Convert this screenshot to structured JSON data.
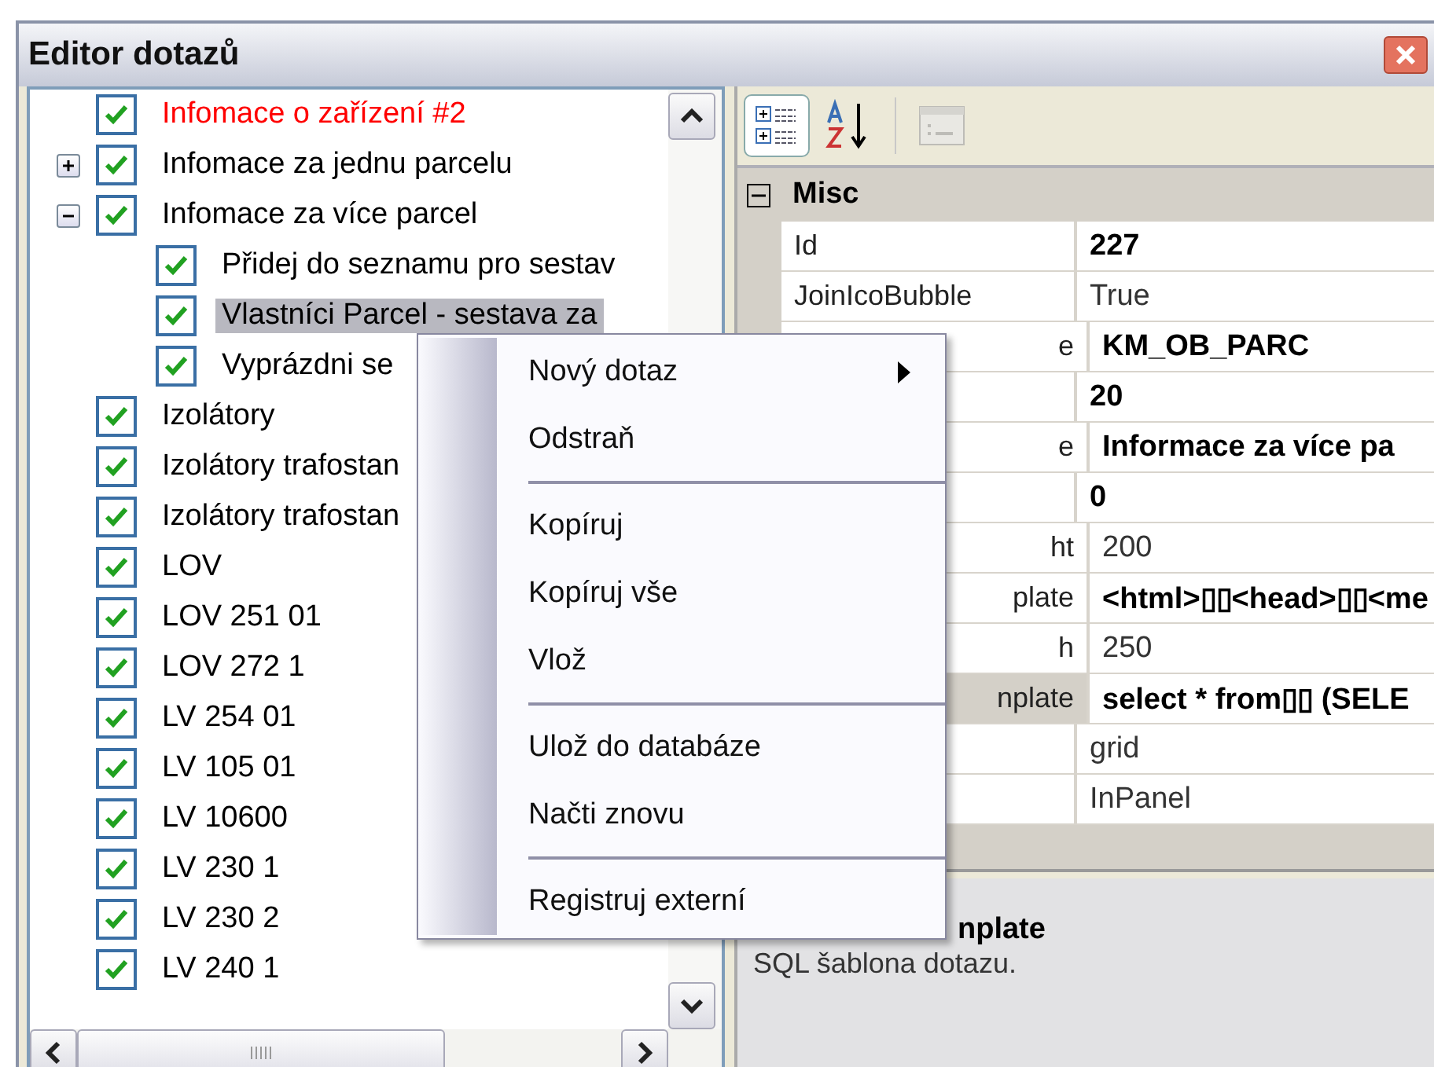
{
  "window": {
    "title": "Editor dotazů"
  },
  "tree": [
    {
      "label": "Infomace o zařízení #2",
      "checked": true,
      "selected": false,
      "color": "#ff0000"
    },
    {
      "label": "Infomace za jednu parcelu",
      "checked": true,
      "selected": false,
      "color": "#000000",
      "expanded": false
    },
    {
      "label": "Infomace za více parcel",
      "checked": true,
      "selected": false,
      "color": "#000000",
      "expanded": true,
      "children": [
        {
          "label": "Přidej do seznamu pro sestav",
          "checked": true,
          "selected": false,
          "color": "#000000"
        },
        {
          "label": "Vlastníci Parcel - sestava za",
          "checked": true,
          "selected": true,
          "color": "#000000"
        },
        {
          "label": "Vyprázdni se",
          "checked": true,
          "selected": false,
          "color": "#000000"
        }
      ]
    },
    {
      "label": "Izolátory",
      "checked": true,
      "selected": false,
      "color": "#000000"
    },
    {
      "label": "Izolátory trafostan",
      "checked": true,
      "selected": false,
      "color": "#000000"
    },
    {
      "label": "Izolátory trafostan",
      "checked": true,
      "selected": false,
      "color": "#000000"
    },
    {
      "label": "LOV",
      "checked": true,
      "selected": false,
      "color": "#000000"
    },
    {
      "label": "LOV 251 01",
      "checked": true,
      "selected": false,
      "color": "#000000"
    },
    {
      "label": "LOV 272 1",
      "checked": true,
      "selected": false,
      "color": "#000000"
    },
    {
      "label": "LV  254 01",
      "checked": true,
      "selected": false,
      "color": "#000000"
    },
    {
      "label": "LV 105 01",
      "checked": true,
      "selected": false,
      "color": "#000000"
    },
    {
      "label": "LV 10600",
      "checked": true,
      "selected": false,
      "color": "#000000"
    },
    {
      "label": "LV 230 1",
      "checked": true,
      "selected": false,
      "color": "#000000"
    },
    {
      "label": "LV 230 2",
      "checked": true,
      "selected": false,
      "color": "#000000"
    },
    {
      "label": "LV 240 1",
      "checked": true,
      "selected": false,
      "color": "#000000"
    }
  ],
  "property_grid": {
    "category": {
      "label": "Misc",
      "expanded": true
    },
    "rows": [
      {
        "name": "Id",
        "value": "227",
        "bold": true,
        "selected": false,
        "cut": false
      },
      {
        "name": "JoinIcoBubble",
        "value": "True",
        "bold": false,
        "selected": false,
        "cut": false
      },
      {
        "name": "e",
        "value": "KM_OB_PARC",
        "bold": true,
        "selected": false,
        "cut": true
      },
      {
        "value": "20",
        "bold": true,
        "selected": false
      },
      {
        "name": "e",
        "value": "Informace za více pa",
        "bold": true,
        "selected": false,
        "cut": true
      },
      {
        "value": "0",
        "bold": true,
        "selected": false
      },
      {
        "name": "ht",
        "value": "200",
        "bold": false,
        "selected": false,
        "cut": true
      },
      {
        "name": "plate",
        "value": "<html>▯▯<head>▯▯<me",
        "bold": true,
        "selected": false,
        "cut": true
      },
      {
        "name": "h",
        "value": "250",
        "bold": false,
        "selected": false,
        "cut": true
      },
      {
        "name": "nplate",
        "value": "select * from▯▯ (SELE",
        "bold": true,
        "selected": true,
        "cut": true
      },
      {
        "value": "grid",
        "bold": false,
        "selected": false
      },
      {
        "value": "InPanel",
        "bold": false,
        "selected": false
      }
    ]
  },
  "description": {
    "title": "nplate",
    "text": "SQL šablona dotazu."
  },
  "context_menu": [
    {
      "kind": "submenu",
      "label": "Nový dotaz"
    },
    {
      "kind": "item",
      "label": "Odstraň"
    },
    {
      "kind": "separator"
    },
    {
      "kind": "item",
      "label": "Kopíruj"
    },
    {
      "kind": "item",
      "label": "Kopíruj vše"
    },
    {
      "kind": "item",
      "label": "Vlož"
    },
    {
      "kind": "separator"
    },
    {
      "kind": "item",
      "label": "Ulož do databáze"
    },
    {
      "kind": "item",
      "label": "Načti znovu"
    },
    {
      "kind": "separator"
    },
    {
      "kind": "item",
      "label": "Registruj externí"
    }
  ]
}
